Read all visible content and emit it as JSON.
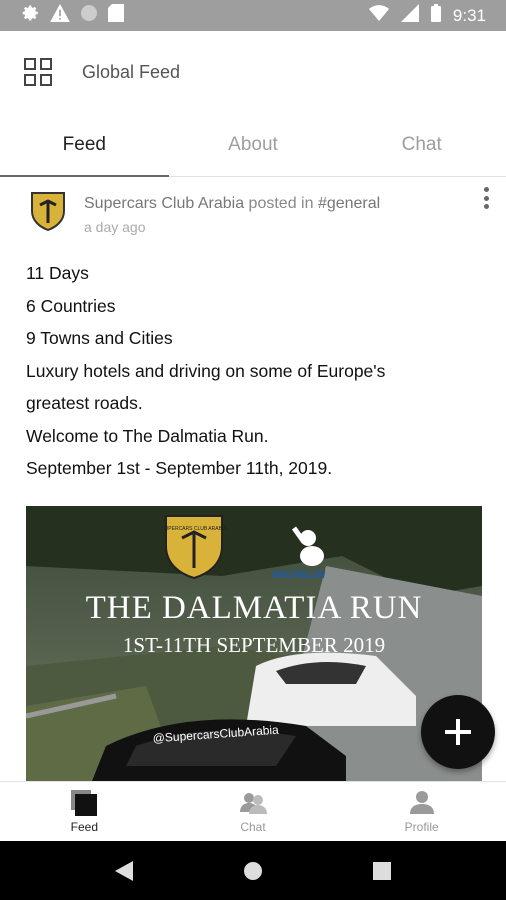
{
  "status_bar": {
    "time": "9:31"
  },
  "app_bar": {
    "title": "Global Feed"
  },
  "tabs": [
    {
      "label": "Feed",
      "active": true
    },
    {
      "label": "About",
      "active": false
    },
    {
      "label": "Chat",
      "active": false
    }
  ],
  "post": {
    "author": "Supercars Club Arabia",
    "posted_in_text": "posted in",
    "channel": "#general",
    "time": "a day ago",
    "lines": [
      "11 Days",
      "6 Countries",
      "9 Towns and Cities",
      "Luxury hotels and driving on some of Europe's",
      "greatest roads.",
      "Welcome to The Dalmatia Run.",
      "September 1st - September 11th, 2019."
    ],
    "image": {
      "title": "THE DALMATIA RUN",
      "subtitle": "1ST-11TH SEPTEMBER 2019",
      "sponsor": "MICHELIN",
      "badge_text": "SUPERCARS CLUB ARABIA",
      "windshield_text": "@SupercarsClubArabia"
    }
  },
  "fab": {
    "icon": "plus-icon"
  },
  "bottom_nav": [
    {
      "label": "Feed",
      "icon": "feed-icon",
      "active": true
    },
    {
      "label": "Chat",
      "icon": "chat-icon",
      "active": false
    },
    {
      "label": "Profile",
      "icon": "profile-icon",
      "active": false
    }
  ],
  "colors": {
    "status_bar": "#9e9e9e",
    "fab": "#111111",
    "active_text": "#222222",
    "inactive_text": "#9e9e9e"
  }
}
